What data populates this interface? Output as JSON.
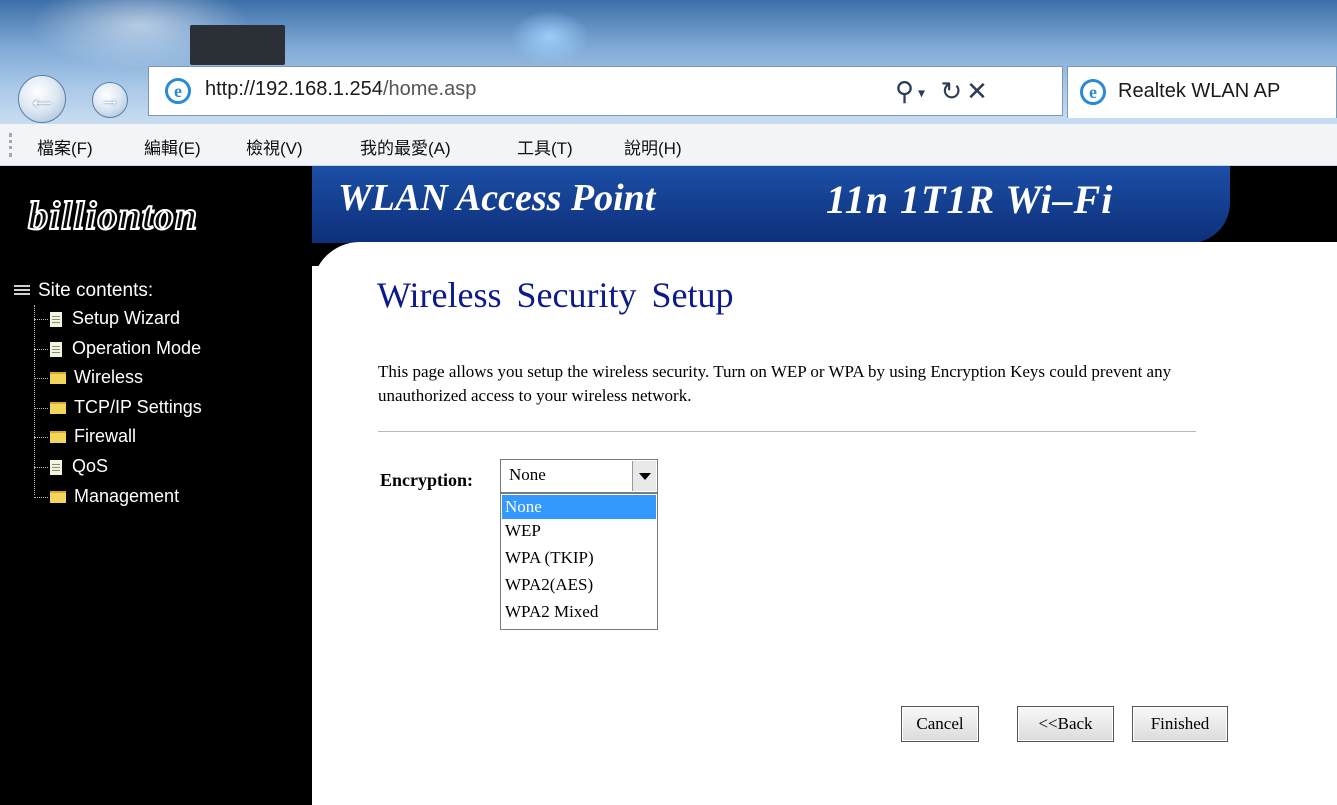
{
  "browser": {
    "url_host": "http://192.168.1.254",
    "url_path": "/home.asp",
    "tab_title": "Realtek WLAN AP",
    "menu": [
      "檔案(F)",
      "編輯(E)",
      "檢視(V)",
      "我的最愛(A)",
      "工具(T)",
      "說明(H)"
    ],
    "icons": [
      "back-arrow-icon",
      "forward-arrow-icon",
      "ie-logo-icon",
      "search-icon",
      "refresh-icon",
      "stop-icon"
    ]
  },
  "banner": {
    "logo": "billionton",
    "title": "WLAN Access Point",
    "subtitle": "11n  1T1R Wi–Fi"
  },
  "sidebar": {
    "heading": "Site contents:",
    "items": [
      {
        "label": "Setup Wizard",
        "icon": "document-icon"
      },
      {
        "label": "Operation Mode",
        "icon": "document-icon"
      },
      {
        "label": "Wireless",
        "icon": "folder-icon"
      },
      {
        "label": "TCP/IP Settings",
        "icon": "folder-icon"
      },
      {
        "label": "Firewall",
        "icon": "folder-icon"
      },
      {
        "label": "QoS",
        "icon": "document-icon"
      },
      {
        "label": "Management",
        "icon": "folder-icon"
      }
    ]
  },
  "main": {
    "title": "Wireless  Security Setup",
    "description": "This page allows you setup the wireless security. Turn on WEP or WPA by using Encryption Keys could prevent any unauthorized access to your wireless network.",
    "encryption": {
      "label": "Encryption:",
      "value": "None",
      "options": [
        "None",
        "WEP",
        "WPA (TKIP)",
        "WPA2(AES)",
        "WPA2 Mixed"
      ],
      "highlighted": "None"
    },
    "buttons": {
      "cancel": "Cancel",
      "back": "<<Back",
      "finished": "Finished"
    }
  },
  "colors": {
    "banner_blue": "#1b4fa6",
    "title_blue": "#0d1a8c",
    "selection": "#3399ff"
  }
}
